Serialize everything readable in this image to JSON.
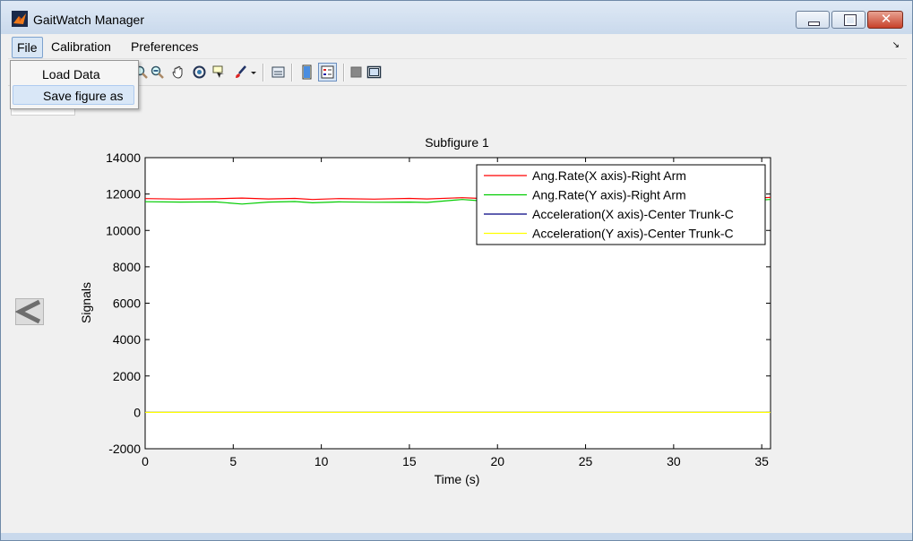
{
  "window": {
    "title": "GaitWatch Manager",
    "close_glyph": "✕"
  },
  "menu": {
    "file": "File",
    "calibration": "Calibration",
    "preferences": "Preferences",
    "overflow_glyph": "↘"
  },
  "file_menu": {
    "items": [
      {
        "label": "Load Data"
      },
      {
        "label": "Save figure as"
      }
    ]
  },
  "toolbar": {
    "icons": [
      "zoom-in-icon",
      "zoom-out-icon",
      "pan-hand-icon",
      "rotate-3d-icon",
      "data-cursor-icon",
      "brush-icon",
      "link-plot-icon",
      "colorbar-icon",
      "legend-icon",
      "hide-plot-tools-icon",
      "show-plot-tools-icon"
    ]
  },
  "nav": {
    "prev_icon": "arrow-left-icon"
  },
  "chart_data": {
    "type": "line",
    "title": "Subfigure 1",
    "xlabel": "Time (s)",
    "ylabel": "Signals",
    "xlim": [
      0,
      35.5
    ],
    "ylim": [
      -2000,
      14000
    ],
    "xticks": [
      "0",
      "5",
      "10",
      "15",
      "20",
      "25",
      "30",
      "35"
    ],
    "yticks": [
      "-2000",
      "0",
      "2000",
      "4000",
      "6000",
      "8000",
      "10000",
      "12000",
      "14000"
    ],
    "grid": false,
    "legend_position": "top-right",
    "series": [
      {
        "name": "Ang.Rate(X axis)-Right Arm",
        "color": "#ff0000",
        "x": [
          0,
          2,
          4,
          5.5,
          7,
          8.5,
          9.5,
          11,
          13,
          15,
          16,
          18,
          19,
          20,
          22,
          24,
          26,
          28,
          30,
          32,
          34,
          35.5
        ],
        "y": [
          11750,
          11720,
          11740,
          11780,
          11730,
          11760,
          11700,
          11750,
          11720,
          11760,
          11730,
          11800,
          11760,
          11740,
          11770,
          11740,
          11760,
          11730,
          11750,
          11760,
          11740,
          11820
        ]
      },
      {
        "name": "Ang.Rate(Y axis)-Right Arm",
        "color": "#00cc00",
        "x": [
          0,
          2,
          4,
          5.5,
          7,
          8.5,
          9.5,
          11,
          13,
          15,
          16,
          18,
          19,
          20,
          22,
          24,
          26,
          28,
          30,
          32,
          34,
          35.5
        ],
        "y": [
          11580,
          11560,
          11570,
          11450,
          11560,
          11590,
          11520,
          11570,
          11550,
          11560,
          11540,
          11700,
          11630,
          11600,
          11610,
          11590,
          11600,
          11620,
          11610,
          11590,
          11620,
          11700
        ]
      },
      {
        "name": "Acceleration(X axis)-Center Trunk-C",
        "color": "#000080",
        "x": [
          0,
          35.5
        ],
        "y": [
          0,
          0
        ]
      },
      {
        "name": "Acceleration(Y axis)-Center Trunk-C",
        "color": "#ffff00",
        "x": [
          0,
          35.5
        ],
        "y": [
          0,
          0
        ]
      }
    ]
  }
}
